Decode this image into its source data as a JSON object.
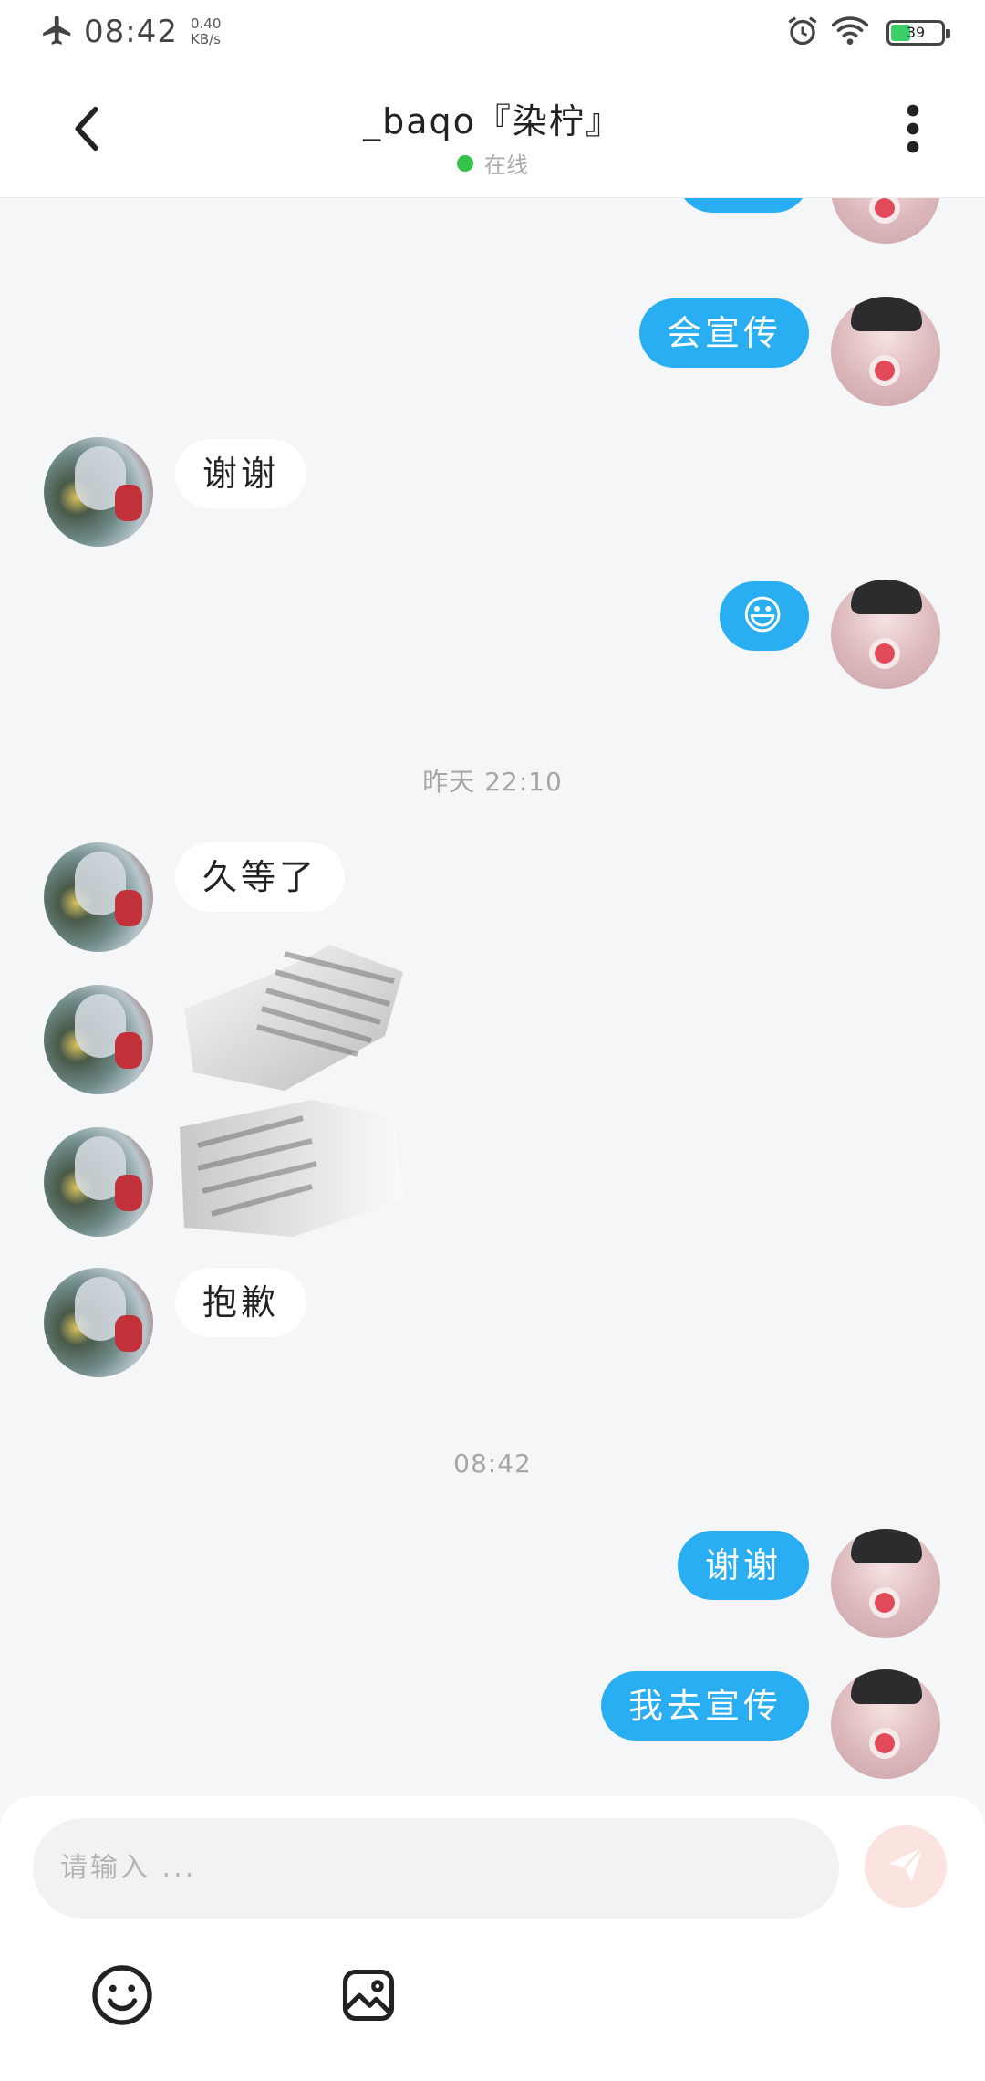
{
  "status_bar": {
    "time": "08:42",
    "speed_value": "0.40",
    "speed_unit": "KB/s",
    "battery": "39",
    "battery_level": 0.39,
    "battery_color": "#3ad06a"
  },
  "header": {
    "title": "_baqo『染柠』",
    "status": "在线",
    "status_color": "#35c24a"
  },
  "messages": {
    "m1": "谢谢",
    "m2": "会宣传",
    "m3": "谢谢",
    "m4": "😃",
    "ts1": "昨天 22:10",
    "m5": "久等了",
    "m6": "抱歉",
    "ts2": "08:42",
    "m7": "谢谢",
    "m8": "我去宣传"
  },
  "composer": {
    "placeholder": "请输入 ..."
  },
  "icons": {
    "back": "chevron-left-icon",
    "more": "more-vertical-icon",
    "send": "send-icon",
    "emoji": "emoji-icon",
    "image": "image-icon"
  },
  "colors": {
    "accent": "#29aef2",
    "background": "#f5f6f8",
    "send_button": "#fbe3e0"
  }
}
